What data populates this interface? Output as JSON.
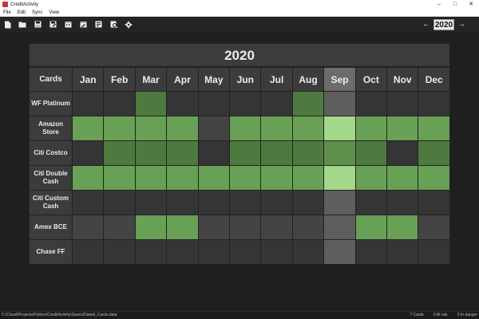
{
  "window": {
    "title": "CreditActivity",
    "minimize": "–",
    "maximize": "□",
    "close": "✕"
  },
  "menu": [
    "File",
    "Edit",
    "Sync",
    "View"
  ],
  "toolbar": {
    "icons": [
      "new-file-icon",
      "open-folder-icon",
      "save-icon",
      "save-as-icon",
      "calendar-icon",
      "calendar-edit-icon",
      "report-icon",
      "search-report-icon",
      "settings-icon"
    ],
    "prev": "←",
    "next": "→",
    "year": "2020"
  },
  "grid": {
    "year_title": "2020",
    "cards_header": "Cards",
    "months": [
      "Jan",
      "Feb",
      "Mar",
      "Apr",
      "May",
      "Jun",
      "Jul",
      "Aug",
      "Sep",
      "Oct",
      "Nov",
      "Dec"
    ],
    "selected_month_index": 8,
    "colors": {
      "empty": "#353535",
      "empty_sel": "#5e5e5e",
      "dark": "#4e7a3f",
      "bright": "#68a055",
      "bright_sel": "#a3d88a",
      "mid": "#5f8f4d",
      "gray": "#444444"
    },
    "rows": [
      {
        "card": "WF Platinum",
        "cells": [
          "empty",
          "empty",
          "dark",
          "empty",
          "empty",
          "empty",
          "empty",
          "dark",
          "empty_sel",
          "empty",
          "empty",
          "empty"
        ]
      },
      {
        "card": "Amazon Store",
        "cells": [
          "bright",
          "bright",
          "bright",
          "bright",
          "gray",
          "bright",
          "bright",
          "bright",
          "bright_sel",
          "bright",
          "bright",
          "bright"
        ]
      },
      {
        "card": "Citi Costco",
        "cells": [
          "empty",
          "dark",
          "dark",
          "dark",
          "empty",
          "dark",
          "dark",
          "dark",
          "mid",
          "dark",
          "empty",
          "dark"
        ]
      },
      {
        "card": "Citi Double Cash",
        "cells": [
          "bright",
          "bright",
          "bright",
          "bright",
          "bright",
          "bright",
          "bright",
          "bright",
          "bright_sel",
          "bright",
          "bright",
          "bright"
        ]
      },
      {
        "card": "Citi Custom Cash",
        "cells": [
          "empty",
          "empty",
          "empty",
          "empty",
          "empty",
          "empty",
          "empty",
          "empty",
          "empty_sel",
          "empty",
          "empty",
          "empty"
        ]
      },
      {
        "card": "Amex BCE",
        "cells": [
          "gray",
          "gray",
          "bright",
          "bright",
          "gray",
          "gray",
          "gray",
          "gray",
          "empty_sel",
          "bright",
          "bright",
          "gray"
        ]
      },
      {
        "card": "Chase FF",
        "cells": [
          "empty",
          "empty",
          "empty",
          "empty",
          "empty",
          "empty",
          "empty",
          "empty",
          "empty_sel",
          "empty",
          "empty",
          "empty"
        ]
      }
    ]
  },
  "status": {
    "path": "C:\\Cloud\\Projects\\Python\\CreditActivity\\Saves\\Daniel_Cards.data",
    "cards": "7 Cards",
    "at_risk": "0 At risk",
    "in_danger": "0 In danger"
  }
}
